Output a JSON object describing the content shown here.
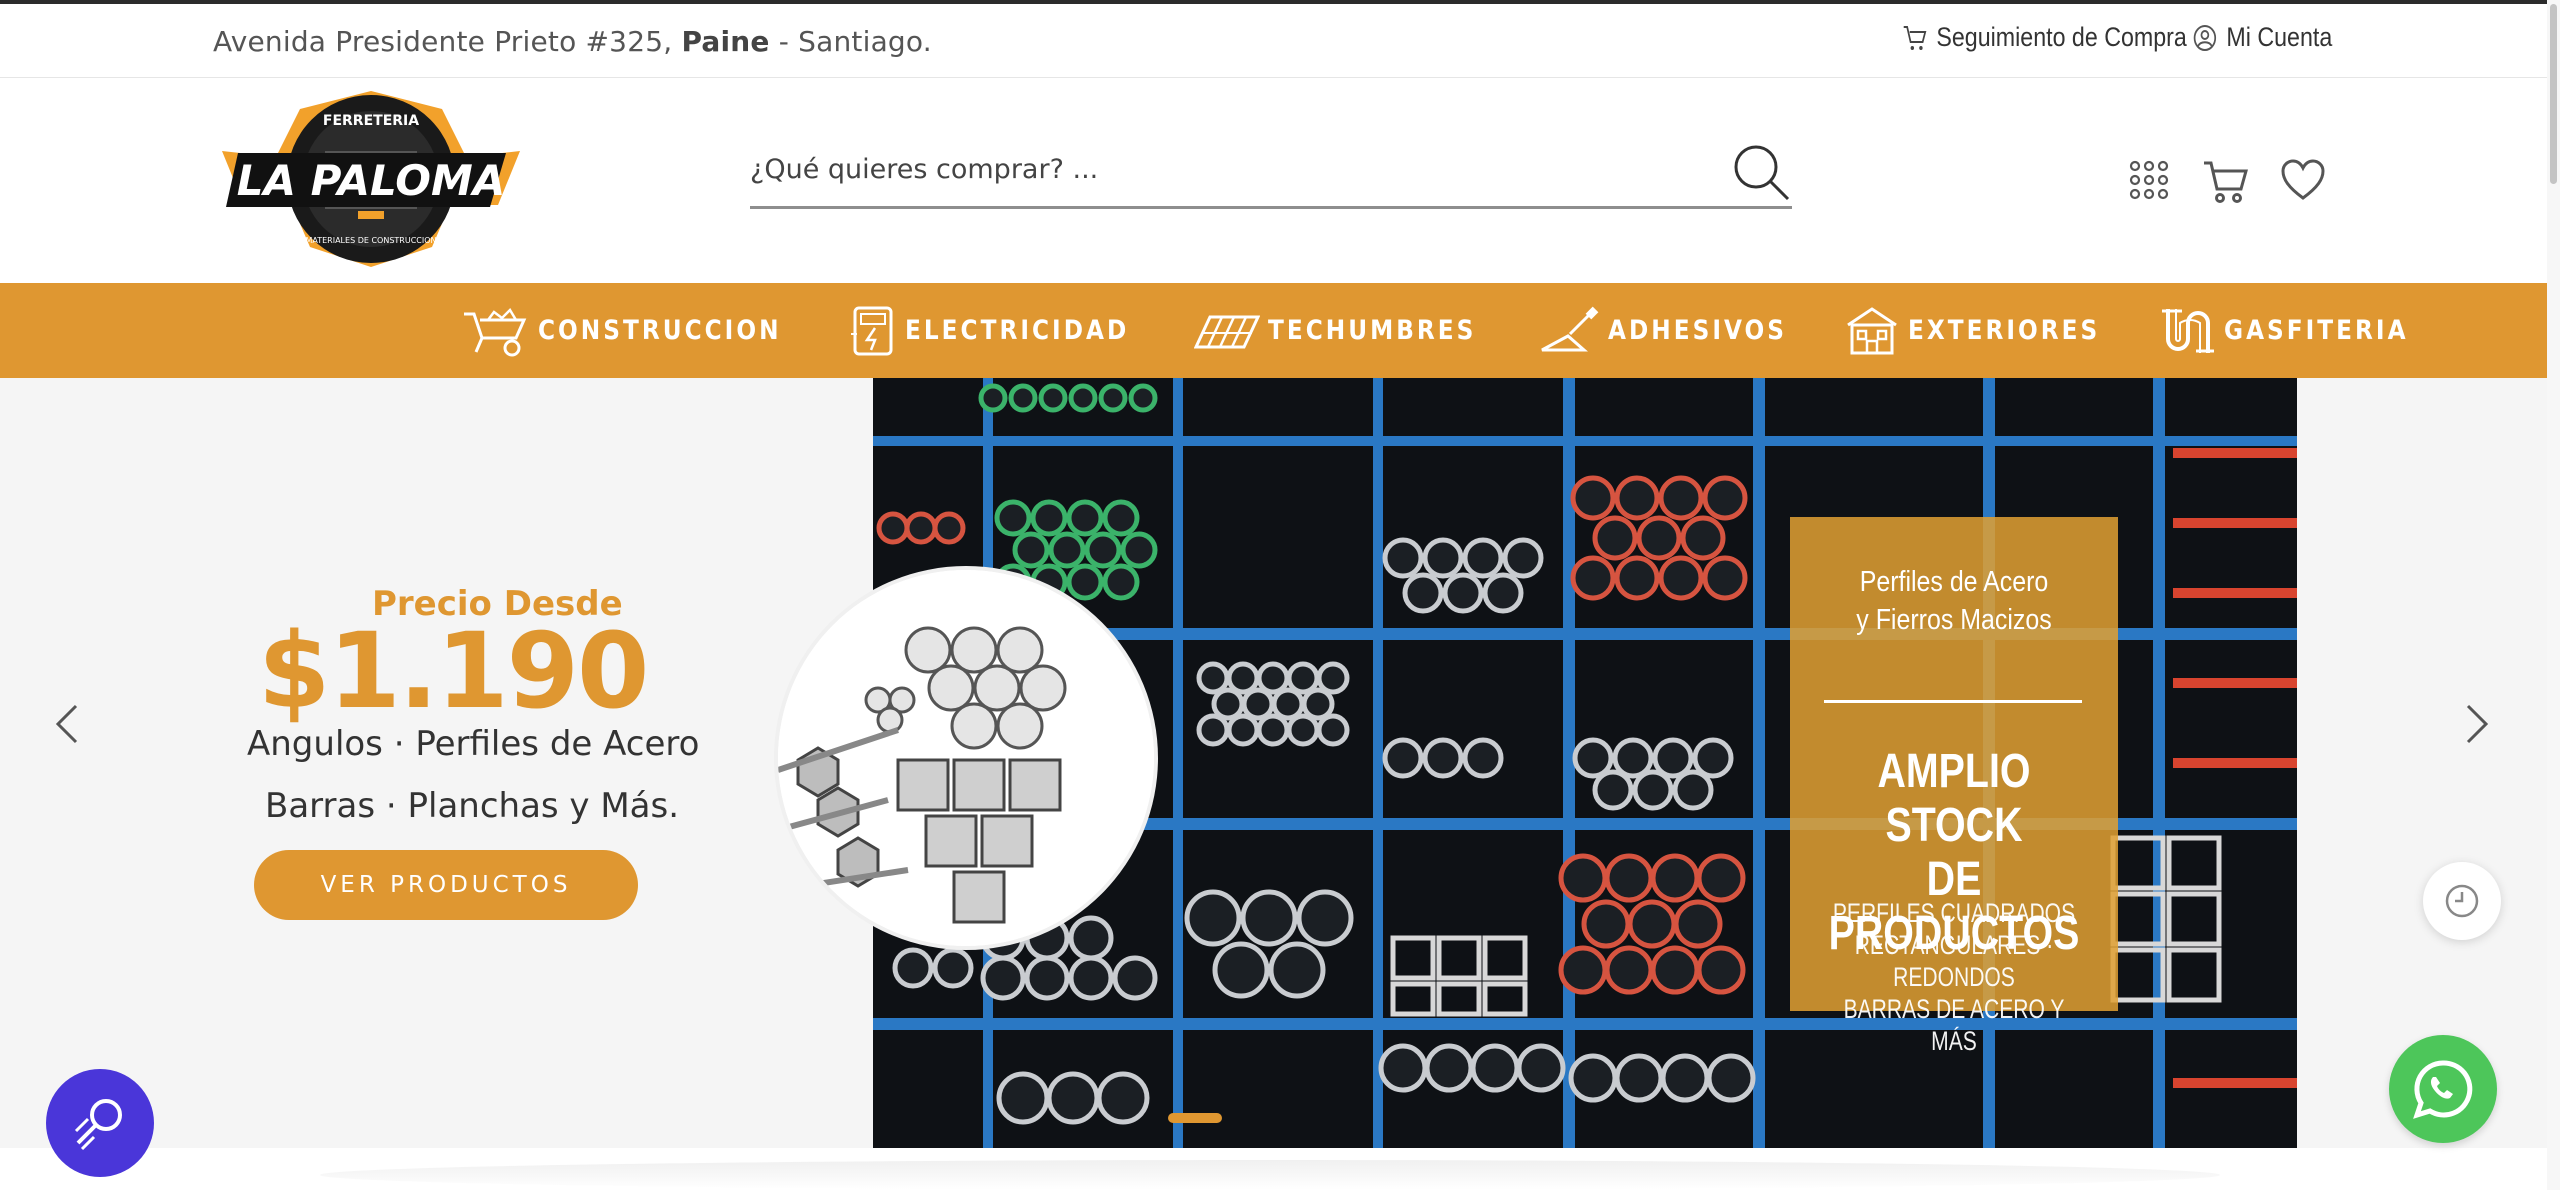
{
  "topbar": {
    "address_prefix": "Avenida Presidente Prieto #325, ",
    "address_bold": "Paine",
    "address_suffix": " - Santiago.",
    "track_order": "Seguimiento de Compra",
    "account": "Mi Cuenta"
  },
  "brand": {
    "logo_top": "FERRETERIA",
    "logo_main": "LA PALOMA",
    "logo_bottom": "MATERIALES DE CONSTRUCCION"
  },
  "search": {
    "placeholder": "¿Qué quieres comprar? ..."
  },
  "header_icons": [
    "apps-grid-icon",
    "cart-icon",
    "heart-icon"
  ],
  "categories": [
    {
      "label": "CONSTRUCCION",
      "icon": "wheelbarrow-icon"
    },
    {
      "label": "ELECTRICIDAD",
      "icon": "electric-meter-icon"
    },
    {
      "label": "TECHUMBRES",
      "icon": "roof-panel-icon"
    },
    {
      "label": "ADHESIVOS",
      "icon": "trowel-icon"
    },
    {
      "label": "EXTERIORES",
      "icon": "house-facade-icon"
    },
    {
      "label": "GASFITERIA",
      "icon": "pipe-icon"
    }
  ],
  "hero": {
    "price_label": "Precio Desde",
    "price": "$1.190",
    "line1": "Angulos · Perfiles de Acero",
    "line2": "Barras · Planchas y Más.",
    "cta": "VER PRODUCTOS"
  },
  "promo": {
    "title_line1": "Perfiles de Acero",
    "title_line2": "y Fierros Macizos",
    "big_line1": "AMPLIO STOCK",
    "big_line2": "DE PRODUCTOS",
    "small_line1": "PERFILES CUADRADOS",
    "small_line2": "RECTANGULARES · REDONDOS",
    "small_line3": "BARRAS DE ACERO Y MÁS"
  },
  "colors": {
    "accent": "#df9731",
    "whatsapp": "#4dc65a",
    "accessibility": "#4a36d9"
  }
}
